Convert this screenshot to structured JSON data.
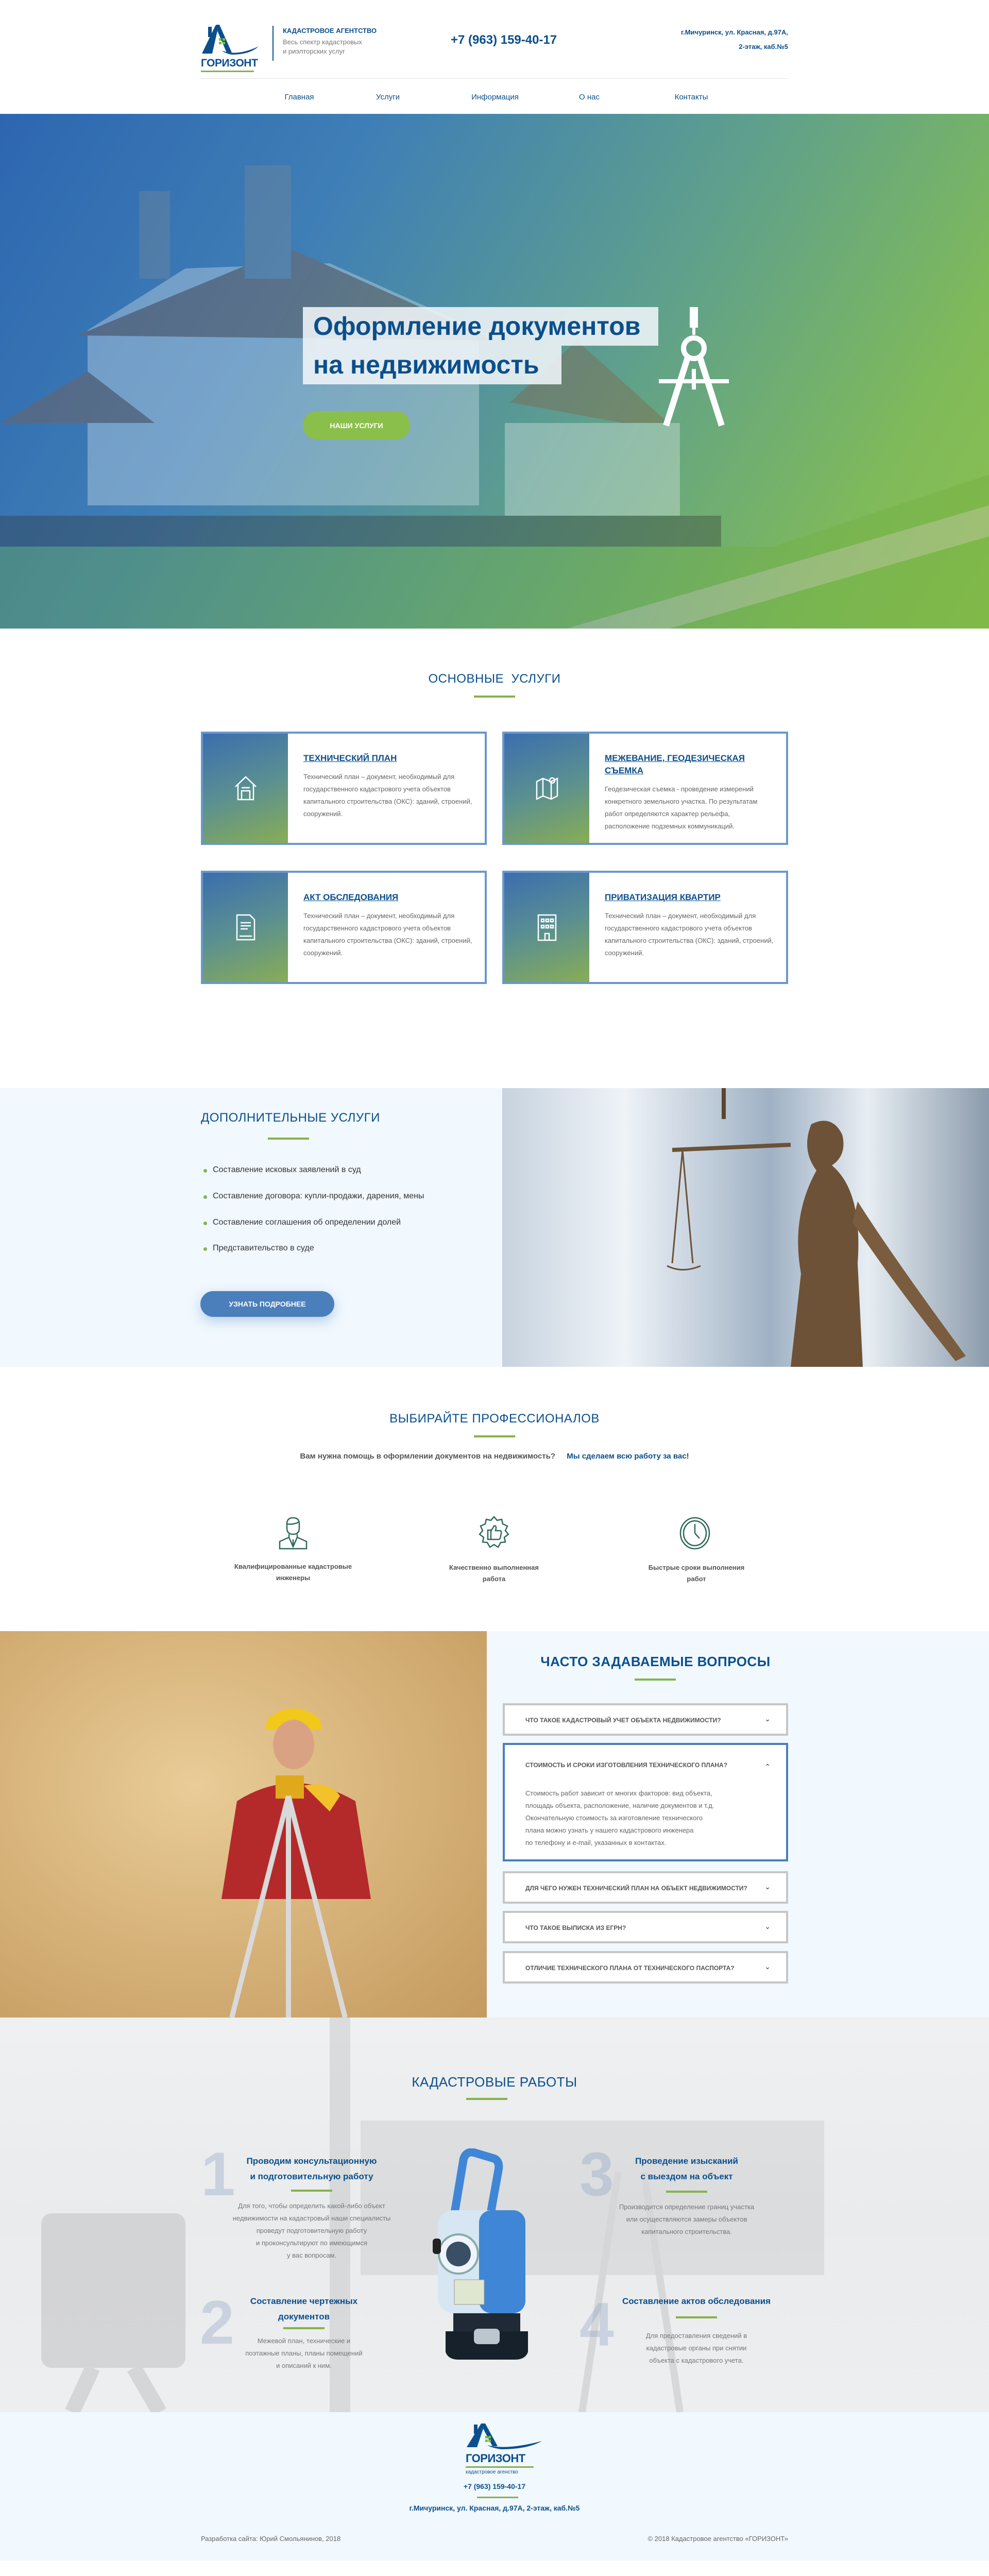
{
  "header": {
    "logo_text": "ГОРИЗОНТ",
    "agency": "КАДАСТРОВОЕ АГЕНТСТВО",
    "tagline_1": "Весь спектр кадастровых",
    "tagline_2": "и риэлторских услуг",
    "phone": "+7 (963) 159-40-17",
    "address_1": "г.Мичуринск, ул. Красная, д.97А,",
    "address_2": "2-этаж, каб.№5"
  },
  "nav": [
    {
      "label": "Главная"
    },
    {
      "label": "Услуги"
    },
    {
      "label": "Информация"
    },
    {
      "label": "О нас"
    },
    {
      "label": "Контакты"
    }
  ],
  "hero": {
    "title_line_1": "Оформление документов",
    "title_line_2": "на недвижимость",
    "button": "НАШИ УСЛУГИ",
    "icon": "compass-icon"
  },
  "services": {
    "title": "ОСНОВНЫЕ  УСЛУГИ",
    "cards": [
      {
        "title": "ТЕХНИЧЕСКИЙ ПЛАН",
        "text": "Технический план – документ, необходимый для государственного кадастрового учета объектов капитального строительства (ОКС): зданий, строений, сооружений.",
        "icon": "house-icon"
      },
      {
        "title": "МЕЖЕВАНИЕ, ГЕОДЕЗИЧЕСКАЯ СЪЕМКА",
        "text": "Геодезическая съемка - проведение измерений конкретного земельного участка. По результатам работ определяются характер рельефа, расположение подземных коммуникаций.",
        "icon": "map-icon"
      },
      {
        "title": "АКТ ОБСЛЕДОВАНИЯ",
        "text": "Технический план – документ, необходимый для государственного кадастрового учета объектов капитального строительства (ОКС): зданий, строений, сооружений.",
        "icon": "document-icon"
      },
      {
        "title": "ПРИВАТИЗАЦИЯ КВАРТИР",
        "text": "Технический план – документ, необходимый для государственного кадастрового учета объектов капитального строительства (ОКС): зданий, строений, сооружений.",
        "icon": "building-icon"
      }
    ]
  },
  "additional": {
    "title": "ДОПОЛНИТЕЛЬНЫЕ УСЛУГИ",
    "items": [
      "Составление исковых заявлений в суд",
      "Составление договора: купли-продажи, дарения, мены",
      "Составление соглашения об определении долей",
      "Представительство в суде"
    ],
    "button": "УЗНАТЬ ПОДРОБНЕЕ"
  },
  "pros": {
    "title": "ВЫБИРАЙТЕ ПРОФЕССИОНАЛОВ",
    "question": "Вам нужна помощь в оформлении документов на недвижимость?",
    "answer": "Мы сделаем всю работу за вас!",
    "features": [
      {
        "line_1": "Квалифицированные кадастровые",
        "line_2": "инженеры",
        "icon": "engineer-icon"
      },
      {
        "line_1": "Качественно выполненная",
        "line_2": "работа",
        "icon": "thumbs-up-badge-icon"
      },
      {
        "line_1": "Быстрые сроки выполнения",
        "line_2": "работ",
        "icon": "clock-icon"
      }
    ]
  },
  "faq": {
    "title": "ЧАСТО ЗАДАВАЕМЫЕ ВОПРОСЫ",
    "items": [
      {
        "q": "ЧТО ТАКОЕ КАДАСТРОВЫЙ УЧЕТ ОБЪЕКТА НЕДВИЖИМОСТИ?",
        "open": false
      },
      {
        "q": "СТОИМОСТЬ И СРОКИ ИЗГОТОВЛЕНИЯ ТЕХНИЧЕСКОГО ПЛАНА?",
        "open": true,
        "a_lines": [
          "Стоимость работ зависит от многих факторов:  вид объекта,",
          "площадь объекта, расположение, наличие документов и т.д.",
          "Окончательную стоимость за изготовление технического",
          "плана можно узнать у нашего кадастрового инженера",
          "по телефону и e-mail, указанных в контактах."
        ]
      },
      {
        "q": "ДЛЯ ЧЕГО НУЖЕН ТЕХНИЧЕСКИЙ ПЛАН НА ОБЪЕКТ НЕДВИЖИМОСТИ?",
        "open": false
      },
      {
        "q": "ЧТО ТАКОЕ ВЫПИСКА ИЗ ЕГРН?",
        "open": false
      },
      {
        "q": "ОТЛИЧИЕ ТЕХНИЧЕСКОГО ПЛАНА ОТ ТЕХНИЧЕСКОГО ПАСПОРТА?",
        "open": false
      }
    ]
  },
  "works": {
    "title": "КАДАСТРОВЫЕ РАБОТЫ",
    "steps": [
      {
        "num": "1",
        "title_1": "Проводим консультационную",
        "title_2": "и подготовительную работу",
        "lines": [
          "Для того, чтобы определить какой-либо объект",
          "недвижимости на кадастровый наши специалисты",
          "проведут подготовительную работу",
          "и проконсультируют по имеющимся",
          "у вас вопросам."
        ]
      },
      {
        "num": "2",
        "title_1": "Составление чертежных",
        "title_2": "документов",
        "lines": [
          "Межевой план, технические и",
          "поэтажные планы, планы помещений",
          "и описаний к ним."
        ]
      },
      {
        "num": "3",
        "title_1": "Проведение изысканий",
        "title_2": "с выездом на объект",
        "lines": [
          "Производится определение границ участка",
          "или осуществляются замеры объектов",
          "капитального строительства."
        ]
      },
      {
        "num": "4",
        "title_1": "Составление актов обследования",
        "title_2": "",
        "lines": [
          "Для предоставления сведений в",
          "кадастровые органы при снятии",
          "объекта с кадастрового учета."
        ]
      }
    ]
  },
  "footer": {
    "logo_text": "ГОРИЗОНТ",
    "logo_sub": "кадастровое агенство",
    "phone": "+7 (963) 159-40-17",
    "address": "г.Мичуринск, ул. Красная, д.97А, 2-этаж, каб.№5",
    "developer": "Разработка сайта: Юрий Смольянинов, 2018",
    "copyright": "© 2018 Кадастровое агентство «ГОРИЗОНТ»"
  },
  "colors": {
    "brand_blue": "#0b4f8c",
    "accent_green": "#86b24a",
    "card_border": "#6b98cc",
    "button_blue": "#4a7fbc",
    "light_bg": "#f1f8fe"
  }
}
